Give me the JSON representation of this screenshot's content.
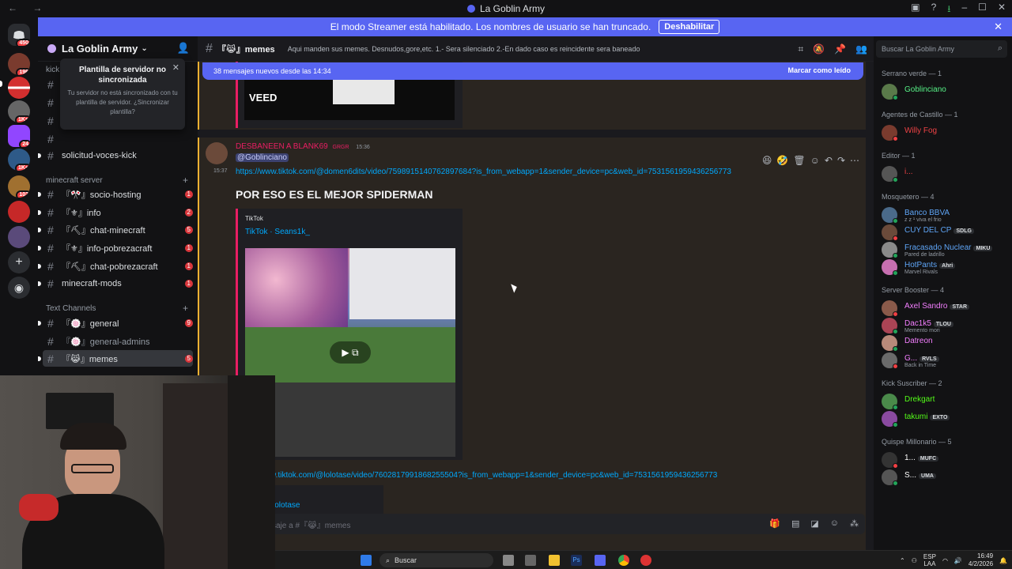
{
  "window": {
    "title": "La Goblin Army",
    "nav": "← →",
    "controls": [
      "▣",
      "?",
      "⭳",
      "–",
      "☐",
      "✕"
    ]
  },
  "banner": {
    "text": "El modo Streamer está habilitado. Los nombres de usuario se han truncado.",
    "button": "Deshabilitar"
  },
  "rail": {
    "badges": [
      "450",
      "196",
      "1K+",
      "24",
      "1K+",
      "103"
    ]
  },
  "server": {
    "name": "La Goblin Army"
  },
  "popup": {
    "title": "Plantilla de servidor no sincronizada",
    "body": "Tu servidor no está sincronizado con tu plantilla de servidor. ¿Sincronizar plantilla?"
  },
  "sidebar": {
    "kick_label": "kick",
    "top_channel": "solicitud-voces-kick",
    "categories": [
      {
        "name": "minecraft server"
      },
      {
        "name": "Text Channels"
      }
    ],
    "minecraft_channels": [
      {
        "name": "『🎌』socio-hosting",
        "count": "1"
      },
      {
        "name": "『⚜』info",
        "count": "2"
      },
      {
        "name": "『⛏』chat-minecraft",
        "count": "5"
      },
      {
        "name": "『⚜』info-pobrezacraft",
        "count": "1"
      },
      {
        "name": "『⛏』chat-pobrezacraft",
        "count": "1"
      },
      {
        "name": "minecraft-mods",
        "count": "1"
      }
    ],
    "text_channels": [
      {
        "name": "『🍥』general",
        "count": "9"
      },
      {
        "name": "『🍥』general-admins",
        "count": ""
      },
      {
        "name": "『😹』memes",
        "count": "5"
      }
    ]
  },
  "channel": {
    "name": "『😹』memes",
    "topic": "Aqui manden sus memes. Desnudos,gore,etc. 1.- Sera silenciado 2.-En dado caso es reincidente sera baneado",
    "search_placeholder": "Buscar La Goblin Army"
  },
  "new_messages": {
    "text": "38 mensajes nuevos desde las 14:34",
    "action": "Marcar como leído"
  },
  "message": {
    "author": "DESBANEEN A BLANK69",
    "tag": "GRGR",
    "time": "15:36",
    "side_time": "15:37",
    "mention": "@Goblinciano",
    "link1": "https://www.tiktok.com/@domen6dits/video/7598915140762897684?is_from_webapp=1&sender_device=pc&web_id=7531561959436256773",
    "caption": "POR ESO ES EL MEJOR SPIDERMAN",
    "embed_provider": "TikTok",
    "embed_author": "TikTok · Seans1k_",
    "link2": "w.tiktok.com/@lolotase/video/7602817991868255504?is_from_webapp=1&sender_device=pc&web_id=7531561959436256773",
    "embed2_author": "lolotase",
    "prev_embed_text": "VEED"
  },
  "input": {
    "placeholder": "saje a #『😹』memes"
  },
  "members": {
    "groups": [
      {
        "title": "Serrano verde — 1",
        "members": [
          {
            "name": "Goblinciano",
            "color": "#57f287",
            "status": ""
          }
        ]
      },
      {
        "title": "Agentes de Castillo — 1",
        "members": [
          {
            "name": "Willy Fog",
            "color": "#ed4245",
            "status": ""
          }
        ]
      },
      {
        "title": "Editor — 1",
        "members": [
          {
            "name": "i...",
            "color": "#ed4245",
            "status": ""
          }
        ]
      },
      {
        "title": "Mosquetero — 4",
        "members": [
          {
            "name": "Banco BBVA",
            "color": "#5ea4f5",
            "status": "z z ¹ viva el frio"
          },
          {
            "name": "CUY DEL CP",
            "color": "#5ea4f5",
            "status": "",
            "tag": "SDLG"
          },
          {
            "name": "Fracasado Nuclear",
            "color": "#5ea4f5",
            "status": "Pared de ladrillo",
            "tag": "MIKU"
          },
          {
            "name": "HotPants",
            "color": "#5ea4f5",
            "status": "Marvel Rivals",
            "tag": "Ahri"
          }
        ]
      },
      {
        "title": "Server Booster — 4",
        "members": [
          {
            "name": "Axel Sandro",
            "color": "#f47fff",
            "status": "",
            "tag": "STAR"
          },
          {
            "name": "Dac1k5",
            "color": "#f47fff",
            "status": "Memento mori",
            "tag": "TLOU"
          },
          {
            "name": "Datreon",
            "color": "#f47fff",
            "status": ""
          },
          {
            "name": "G...",
            "color": "#f47fff",
            "status": "Back in Time",
            "tag": "RVLS"
          }
        ]
      },
      {
        "title": "Kick Suscriber — 2",
        "members": [
          {
            "name": "Drekgart",
            "color": "#53fc18",
            "status": ""
          },
          {
            "name": "takumi",
            "color": "#53fc18",
            "status": "",
            "tag": "EXTO"
          }
        ]
      },
      {
        "title": "Quispe Millonario — 5",
        "members": [
          {
            "name": "1...",
            "color": "#ffffff",
            "status": "",
            "tag": "MUFC"
          },
          {
            "name": "S...",
            "color": "#ffffff",
            "status": "",
            "tag": "UMA"
          }
        ]
      }
    ]
  },
  "taskbar": {
    "search": "Buscar",
    "lang": "ESP",
    "lang2": "LAA",
    "time": "16:49",
    "date": "4/2/2026"
  },
  "colors": {
    "accent": "#5865f2",
    "mention_bg": "#2a2520",
    "embed_bar": "#e91e63",
    "author": "#e91e63"
  }
}
